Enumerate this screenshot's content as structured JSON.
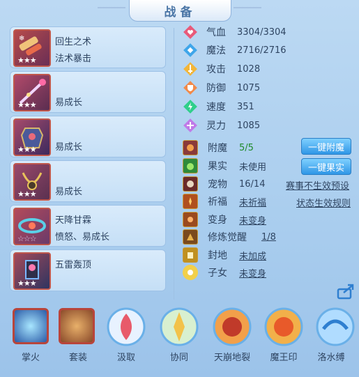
{
  "panel": {
    "title": "战备"
  },
  "items": [
    {
      "name": "回生之术",
      "desc": "法术暴击",
      "stars": "★★★"
    },
    {
      "name": "",
      "desc": "易成长",
      "stars": "★★★"
    },
    {
      "name": "",
      "desc": "易成长",
      "stars": "★★★"
    },
    {
      "name": "",
      "desc": "易成长",
      "stars": "★★★"
    },
    {
      "name": "天降甘霖",
      "desc": "愤怒、易成长",
      "stars": "☆☆☆"
    },
    {
      "name": "五雷轰顶",
      "desc": "",
      "stars": "★★★"
    }
  ],
  "stats": [
    {
      "name": "气血",
      "value": "3304/3304",
      "icon": "heart-icon",
      "color": "#e85a7a"
    },
    {
      "name": "魔法",
      "value": "2716/2716",
      "icon": "diamond-icon",
      "color": "#3fa6ea"
    },
    {
      "name": "攻击",
      "value": "1028",
      "icon": "attack-icon",
      "color": "#f2b63a"
    },
    {
      "name": "防御",
      "value": "1075",
      "icon": "shield-icon",
      "color": "#f28a4a"
    },
    {
      "name": "速度",
      "value": "351",
      "icon": "speed-icon",
      "color": "#2fcf8a"
    },
    {
      "name": "灵力",
      "value": "1085",
      "icon": "spirit-icon",
      "color": "#c07ae8"
    }
  ],
  "features": [
    {
      "name": "附魔",
      "value": "5/5"
    },
    {
      "name": "果实",
      "value": "未使用"
    },
    {
      "name": "宠物",
      "value": "16/14"
    },
    {
      "name": "祈福",
      "value": "未祈福"
    },
    {
      "name": "变身",
      "value": "未变身"
    },
    {
      "name": "修炼觉醒",
      "value": "1/8"
    },
    {
      "name": "封地",
      "value": "未加成"
    },
    {
      "name": "子女",
      "value": "未变身"
    }
  ],
  "buttons": {
    "enchant": "一键附魔",
    "fruit": "一键果实"
  },
  "links": {
    "tournament": "赛事不生效预设",
    "rules": "状态生效规则"
  },
  "skills": [
    {
      "label": "掌火"
    },
    {
      "label": "套装"
    },
    {
      "label": "汲取"
    },
    {
      "label": "协同"
    },
    {
      "label": "天崩地裂"
    },
    {
      "label": "魔王印"
    },
    {
      "label": "洛水缚"
    }
  ]
}
